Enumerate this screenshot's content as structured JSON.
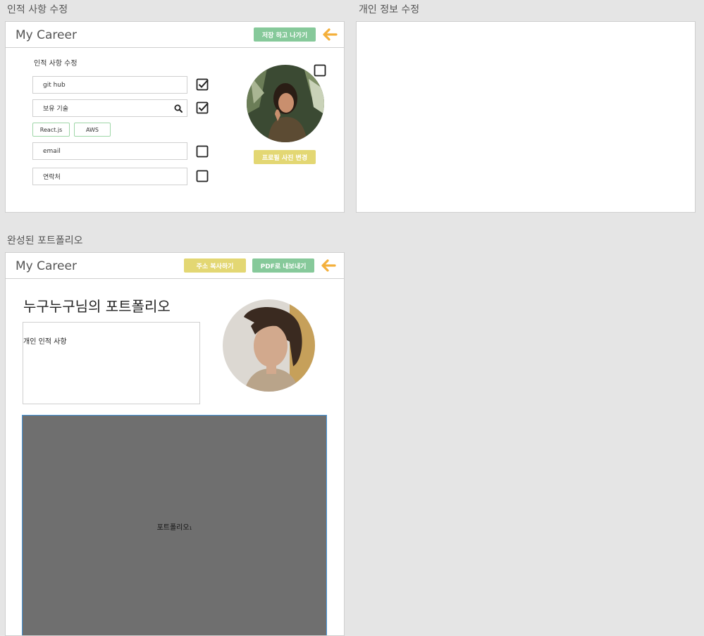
{
  "boards": {
    "edit": {
      "label": "인적 사항 수정"
    },
    "personal": {
      "label": "개인 정보 수정"
    },
    "portfolio": {
      "label": "완성된 포트폴리오"
    }
  },
  "edit_screen": {
    "logo": "My Career",
    "save_exit_label": "저장 하고 나가기",
    "section_title": "인적 사항 수정",
    "fields": [
      {
        "value": "git hub",
        "checked": true
      },
      {
        "value": "보유 기술",
        "checked": true
      },
      {
        "value": "email",
        "checked": false
      },
      {
        "value": "연락처",
        "checked": false
      }
    ],
    "skills": [
      "React.js",
      "AWS"
    ],
    "profile_checked": false,
    "change_photo_label": "프로필 사진 변경"
  },
  "portfolio_screen": {
    "logo": "My Career",
    "copy_address_label": "주소 복사하기",
    "export_pdf_label": "PDF로 내보내기",
    "user_name": "누구누구",
    "title_suffix": "님의 포트폴리오",
    "info_box_text": "개인 인적 사항",
    "portfolio_label": "포트폴리오",
    "portfolio_index": "1"
  },
  "colors": {
    "accent_green": "#86c99a",
    "accent_yellow": "#e3d773",
    "back_arrow": "#f4b03c",
    "portfolio_block": "#6f6f6f"
  }
}
